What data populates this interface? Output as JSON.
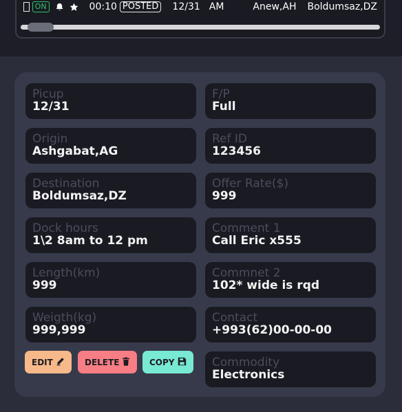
{
  "row": {
    "status_badge": "ON",
    "time": "00:10",
    "posted_badge": "POSTED",
    "date": "12/31",
    "ampm": "AM",
    "origin": "Anew,AH",
    "destination": "Boldumsaz,DZ"
  },
  "fields": {
    "pickup": {
      "label": "Picup",
      "value": "12/31"
    },
    "fp": {
      "label": "F/P",
      "value": "Full"
    },
    "origin": {
      "label": "Origin",
      "value": "Ashgabat,AG"
    },
    "ref_id": {
      "label": "Ref ID",
      "value": "123456"
    },
    "destination": {
      "label": "Destination",
      "value": "Boldumsaz,DZ"
    },
    "offer_rate": {
      "label": "Offer Rate($)",
      "value": "999"
    },
    "dock_hours": {
      "label": "Dock hours",
      "value": "1\\2 8am to 12 pm"
    },
    "comment1": {
      "label": "Comment 1",
      "value": "Call Eric x555"
    },
    "length": {
      "label": "Length(km)",
      "value": "999"
    },
    "comment2": {
      "label": "Commnet 2",
      "value": "102* wide is rqd"
    },
    "weight": {
      "label": "Weigth(kg)",
      "value": "999,999"
    },
    "contact": {
      "label": "Contact",
      "value": "+993(62)00-00-00"
    },
    "commodity": {
      "label": "Commodity",
      "value": "Electronics"
    }
  },
  "buttons": {
    "edit": "EDIT",
    "delete": "DELETE",
    "copy": "COPY"
  },
  "colors": {
    "on_green": "#2cc66b",
    "edit": "#f7b98a",
    "delete": "#f67e84",
    "copy": "#78e9d2"
  },
  "icons": {
    "bell": "bell-icon",
    "star": "star-icon",
    "edit": "pencil-icon",
    "delete": "trash-icon",
    "copy": "save-icon"
  }
}
